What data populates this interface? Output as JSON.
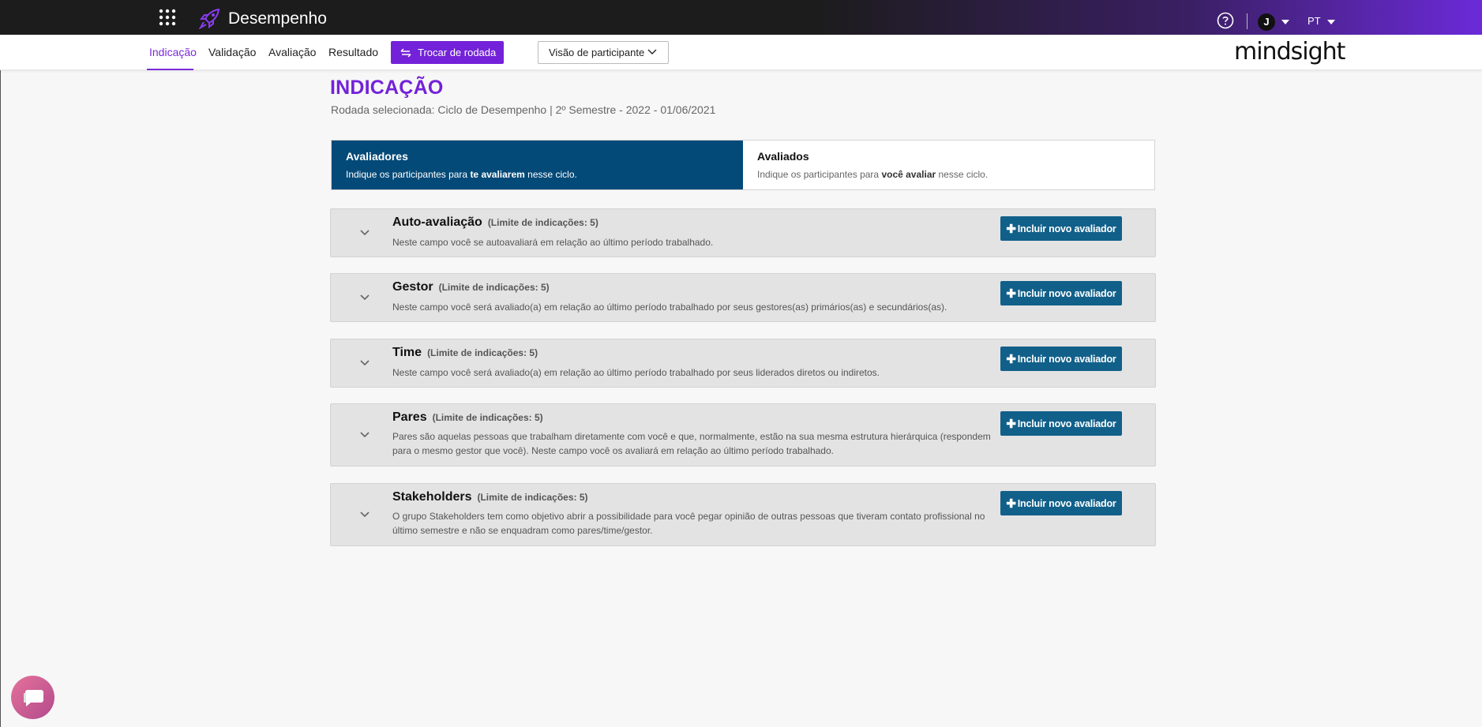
{
  "header": {
    "app_title": "Desempenho",
    "user_initial": "J",
    "language": "PT",
    "icons": [
      "apps-grid-icon",
      "rocket-icon",
      "help-icon",
      "caret-down-icon"
    ]
  },
  "nav": {
    "items": [
      {
        "label": "Indicação",
        "active": true
      },
      {
        "label": "Validação",
        "active": false
      },
      {
        "label": "Avaliação",
        "active": false
      },
      {
        "label": "Resultado",
        "active": false
      }
    ],
    "swap_round_label": "Trocar de rodada",
    "view_select_value": "Visão de participante",
    "brand": "mindsight"
  },
  "page": {
    "title": "INDICAÇÃO",
    "round_info": "Rodada selecionada: Ciclo de Desempenho | 2º Semestre - 2022 - 01/06/2021"
  },
  "segment": {
    "evaluators": {
      "title": "Avaliadores",
      "sub_pre": "Indique os participantes para ",
      "sub_bold": "te avaliarem",
      "sub_post": " nesse ciclo.",
      "active": true
    },
    "evaluated": {
      "title": "Avaliados",
      "sub_pre": "Indique os participantes para ",
      "sub_bold": "você avaliar",
      "sub_post": " nesse ciclo.",
      "active": false
    }
  },
  "add_button_label": "Incluir novo avaliador",
  "sections": [
    {
      "name": "Auto-avaliação",
      "limit": "(Limite de indicações: 5)",
      "description": "Neste campo você se autoavaliará em relação ao último período trabalhado."
    },
    {
      "name": "Gestor",
      "limit": "(Limite de indicações: 5)",
      "description": "Neste campo você será avaliado(a) em relação ao último período trabalhado por seus gestores(as) primários(as) e secundários(as)."
    },
    {
      "name": "Time",
      "limit": "(Limite de indicações: 5)",
      "description": "Neste campo você será avaliado(a) em relação ao último período trabalhado por seus liderados diretos ou indiretos."
    },
    {
      "name": "Pares",
      "limit": "(Limite de indicações: 5)",
      "description": "Pares são aquelas pessoas que trabalham diretamente com você e que, normalmente, estão na sua mesma estrutura hierárquica (respondem para o mesmo gestor que você). Neste campo você os avaliará em relação ao último período trabalhado."
    },
    {
      "name": "Stakeholders",
      "limit": "(Limite de indicações: 5)",
      "description": "O grupo Stakeholders tem como objetivo abrir a possibilidade para você pegar opinião de outras pessoas que tiveram contato profissional no último semestre e não se enquadram como pares/time/gestor."
    }
  ],
  "colors": {
    "accent": "#7322d9",
    "active_tab_bg": "#044a78",
    "add_button_bg": "#11608a",
    "card_bg": "#e3e3e3"
  }
}
